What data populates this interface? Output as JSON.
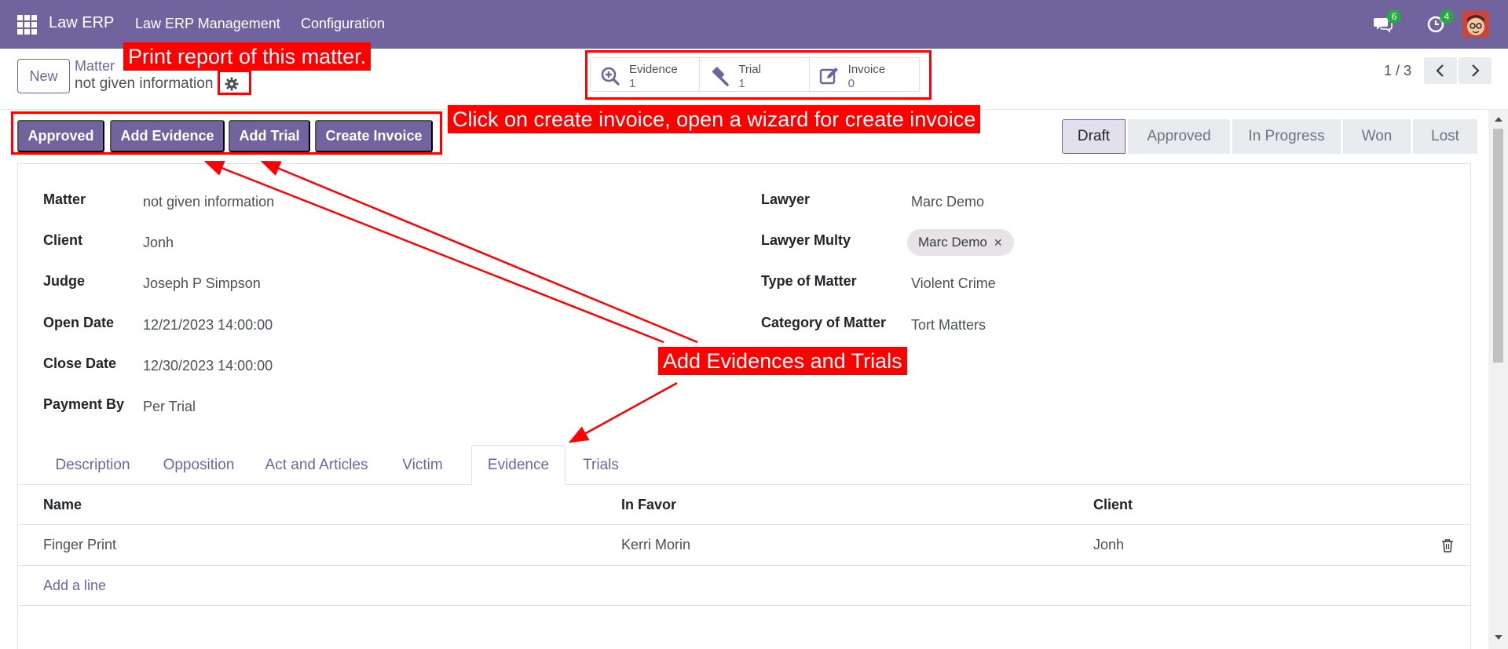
{
  "navbar": {
    "app_name": "Law ERP",
    "menu": [
      "Law ERP Management",
      "Configuration"
    ],
    "messages_count": "6",
    "activities_count": "4"
  },
  "control": {
    "new_label": "New",
    "breadcrumb_parent": "Matter",
    "breadcrumb_current": "not given information",
    "pager": "1 / 3"
  },
  "smart_buttons": [
    {
      "label": "Evidence",
      "value": "1",
      "icon": "search-plus-icon"
    },
    {
      "label": "Trial",
      "value": "1",
      "icon": "gavel-icon"
    },
    {
      "label": "Invoice",
      "value": "0",
      "icon": "edit-icon"
    }
  ],
  "actions": [
    "Approved",
    "Add Evidence",
    "Add Trial",
    "Create Invoice"
  ],
  "stages": [
    "Draft",
    "Approved",
    "In Progress",
    "Won",
    "Lost"
  ],
  "active_stage": "Draft",
  "form": {
    "left": [
      {
        "label": "Matter",
        "value": "not given information"
      },
      {
        "label": "Client",
        "value": "Jonh"
      },
      {
        "label": "Judge",
        "value": "Joseph P Simpson"
      },
      {
        "label": "Open Date",
        "value": "12/21/2023 14:00:00"
      },
      {
        "label": "Close Date",
        "value": "12/30/2023 14:00:00"
      },
      {
        "label": "Payment By",
        "value": "Per Trial"
      }
    ],
    "right": [
      {
        "label": "Lawyer",
        "value": "Marc Demo"
      },
      {
        "label": "Lawyer Multy",
        "value": "Marc Demo"
      },
      {
        "label": "Type of Matter",
        "value": "Violent Crime"
      },
      {
        "label": "Category of Matter",
        "value": "Tort Matters"
      }
    ]
  },
  "tabs": [
    "Description",
    "Opposition",
    "Act and Articles",
    "Victim",
    "Evidence",
    "Trials"
  ],
  "active_tab": "Evidence",
  "table": {
    "headers": [
      "Name",
      "In Favor",
      "Client"
    ],
    "rows": [
      [
        "Finger Print",
        "Kerri Morin",
        "Jonh"
      ]
    ],
    "add_line": "Add a line"
  },
  "annotations": {
    "print": "Print report of this matter.",
    "invoice": "Click on create invoice, open a wizard for create invoice",
    "evidence": "Add Evidences and Trials"
  },
  "colors": {
    "brand": "#71639e",
    "annotation": "#ff0000",
    "badge": "#28a745"
  }
}
